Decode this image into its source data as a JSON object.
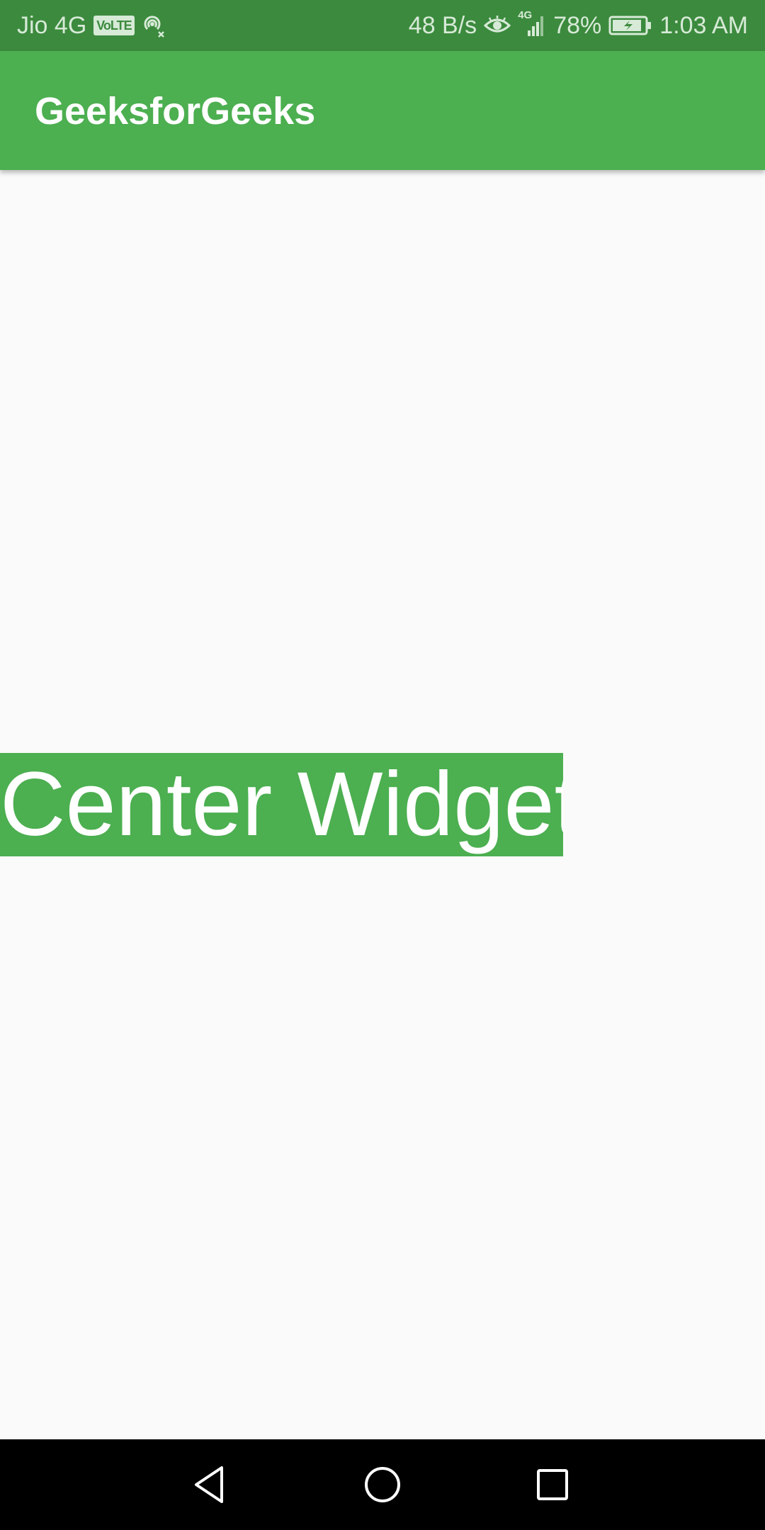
{
  "status_bar": {
    "carrier": "Jio 4G",
    "volte": "VoLTE",
    "speed": "48 B/s",
    "network_type": "4G",
    "battery": "78%",
    "time": "1:03 AM",
    "icons": [
      "hotspot-icon",
      "eye-icon",
      "signal-icon",
      "battery-charging-icon"
    ]
  },
  "app_bar": {
    "title": "GeeksforGeeks"
  },
  "body": {
    "center_text": "Center Widget"
  },
  "nav_bar": {
    "icons": [
      "back-icon",
      "home-icon",
      "recents-icon"
    ]
  },
  "colors": {
    "primary": "#4caf50",
    "status_bar": "#3c8a3e",
    "background": "#fafafa",
    "nav_bar": "#000000"
  }
}
